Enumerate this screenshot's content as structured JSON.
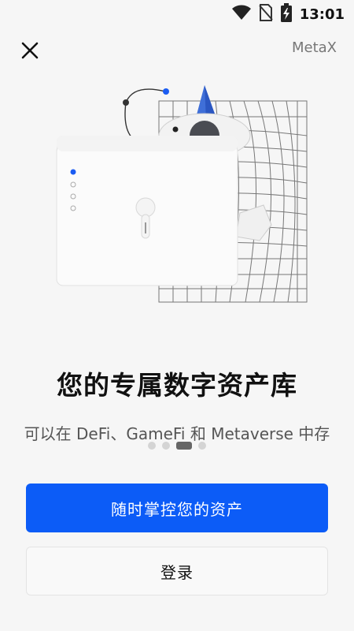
{
  "status_bar": {
    "time": "13:01",
    "icons": [
      "wifi-icon",
      "no-sim-icon",
      "battery-charging-icon"
    ]
  },
  "header": {
    "close_icon": "close-icon",
    "brand": "MetaX"
  },
  "hero": {
    "title": "您的专属数字资产库",
    "subtitle": "可以在 DeFi、GameFi 和 Metaverse 中存"
  },
  "pager": {
    "count": 4,
    "active_index": 2
  },
  "actions": {
    "primary_label": "随时掌控您的资产",
    "secondary_label": "登录"
  },
  "colors": {
    "primary": "#0c5cf7",
    "background": "#f6f6f6"
  }
}
